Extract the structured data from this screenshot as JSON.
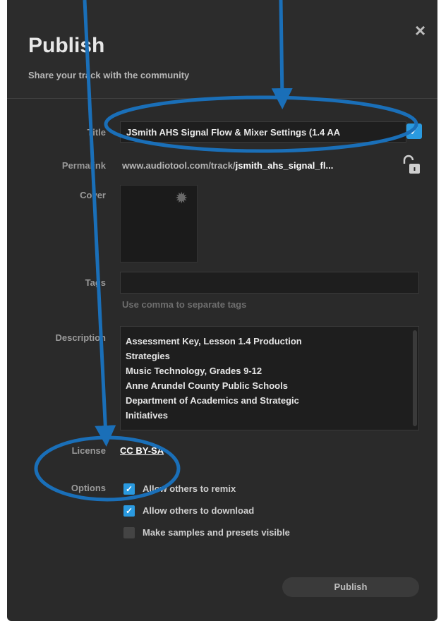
{
  "dialog": {
    "title": "Publish",
    "subtitle": "Share your track with the community",
    "close_icon": "×"
  },
  "fields": {
    "title_label": "Title",
    "title_value": "JSmith AHS Signal Flow & Mixer Settings (1.4 AA",
    "title_check": "✓",
    "permalink_label": "Permalink",
    "permalink_prefix": "www.audiotool.com/track/",
    "permalink_slug": "jsmith_ahs_signal_fl...",
    "cover_label": "Cover",
    "gear_icon": "✹",
    "tags_label": "Tags",
    "tags_hint": "Use comma to separate tags",
    "description_label": "Description",
    "description_lines": [
      "Assessment Key, Lesson 1.4 Production",
      "Strategies",
      "Music Technology, Grades 9-12",
      "Anne Arundel County Public Schools",
      "Department of Academics and Strategic",
      "Initiatives"
    ],
    "license_label": "License",
    "license_value": "CC BY-SA",
    "options_label": "Options"
  },
  "options": [
    {
      "label": "Allow others to remix",
      "checked": true,
      "mark": "✓"
    },
    {
      "label": "Allow others to download",
      "checked": true,
      "mark": "✓"
    },
    {
      "label": "Make samples and presets visible",
      "checked": false,
      "mark": ""
    }
  ],
  "footer": {
    "publish_label": "Publish"
  },
  "colors": {
    "accent": "#2a9ae0",
    "annotation": "#1a6fb8",
    "dialog_bg": "#2a2a2a"
  }
}
